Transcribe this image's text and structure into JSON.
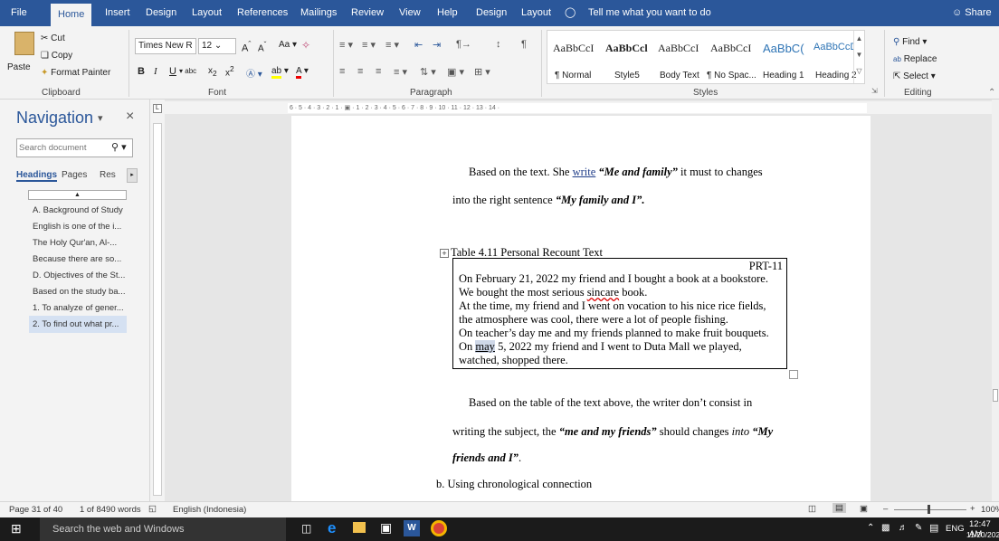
{
  "tabs": {
    "file": "File",
    "home": "Home",
    "insert": "Insert",
    "design": "Design",
    "layout": "Layout",
    "references": "References",
    "mailings": "Mailings",
    "review": "Review",
    "view": "View",
    "help": "Help",
    "design2": "Design",
    "layout2": "Layout",
    "tell_me": "Tell me what you want to do",
    "share": "Share"
  },
  "clipboard": {
    "cut": "Cut",
    "copy": "Copy",
    "paste": "Paste",
    "format_painter": "Format Painter",
    "label": "Clipboard"
  },
  "font": {
    "name": "Times New R",
    "size": "12",
    "label": "Font"
  },
  "paragraph": {
    "label": "Paragraph"
  },
  "styles": {
    "label": "Styles",
    "items": [
      {
        "preview": "AaBbCcI",
        "name": "¶ Normal"
      },
      {
        "preview": "AaBbCcl",
        "name": "Style5"
      },
      {
        "preview": "AaBbCcI",
        "name": "Body Text"
      },
      {
        "preview": "AaBbCcI",
        "name": "¶ No Spac..."
      },
      {
        "preview": "AaBbC(",
        "name": "Heading 1"
      },
      {
        "preview": "AaBbCcD",
        "name": "Heading 2"
      }
    ]
  },
  "editing": {
    "find": "Find",
    "replace": "Replace",
    "select": "Select",
    "label": "Editing"
  },
  "nav": {
    "title": "Navigation",
    "search_placeholder": "Search document",
    "tab_headings": "Headings",
    "tab_pages": "Pages",
    "tab_results": "Res",
    "items": [
      "A. Background of Study",
      "English is one of the i...",
      "The Holy Qur'an, Al-...",
      "Because there are so...",
      "D. Objectives of the St...",
      "Based on the study ba...",
      "1. To analyze of gener...",
      "2. To find out what pr..."
    ]
  },
  "document": {
    "para1_a": "Based on the text. She",
    "para1_write": "write",
    "para1_quote": "“Me and family”",
    "para1_b": "it must to changes",
    "para2_a": "into the right sentence",
    "para2_quote": "“My family and I”.",
    "table_caption": "Table 4.11 Personal Recount Text",
    "table_code": "PRT-11",
    "line1": "On February 21, 2022 my friend and I bought a book at a bookstore.",
    "line2_a": "We bought the most serious",
    "line2_sincare": "sincare",
    "line2_b": "book.",
    "line3": "At the time, my friend and I went on vocation to his nice rice fields,",
    "line4": "the atmosphere was cool, there were a lot of people fishing.",
    "line5": "On teacher’s day me and my friends planned to make fruit bouquets.",
    "line6_a": "On",
    "line6_may": "may",
    "line6_b": "5, 2022 my friend and I went to Duta Mall we played,",
    "line7": "watched, shopped there.",
    "para3": "Based on the table of the text above, the writer don’t consist in",
    "para4_a": "writing the subject, the",
    "para4_quote": "“me and my friends”",
    "para4_b": "should changes",
    "para4_into": "into",
    "para4_quote2": "“My",
    "para5_quote": "friends and I”",
    "para5_end": ".",
    "list_b": "b.  Using chronological connection"
  },
  "status": {
    "page": "Page 31 of 40",
    "words": "1 of 8490 words",
    "language": "English (Indonesia)",
    "zoom": "100%"
  },
  "taskbar": {
    "search": "Search the web and Windows",
    "lang": "ENG",
    "time": "12:47 AM",
    "date": "11/20/2023"
  },
  "colors": {
    "accent": "#2b579a",
    "taskbar": "#1b1b1b"
  }
}
